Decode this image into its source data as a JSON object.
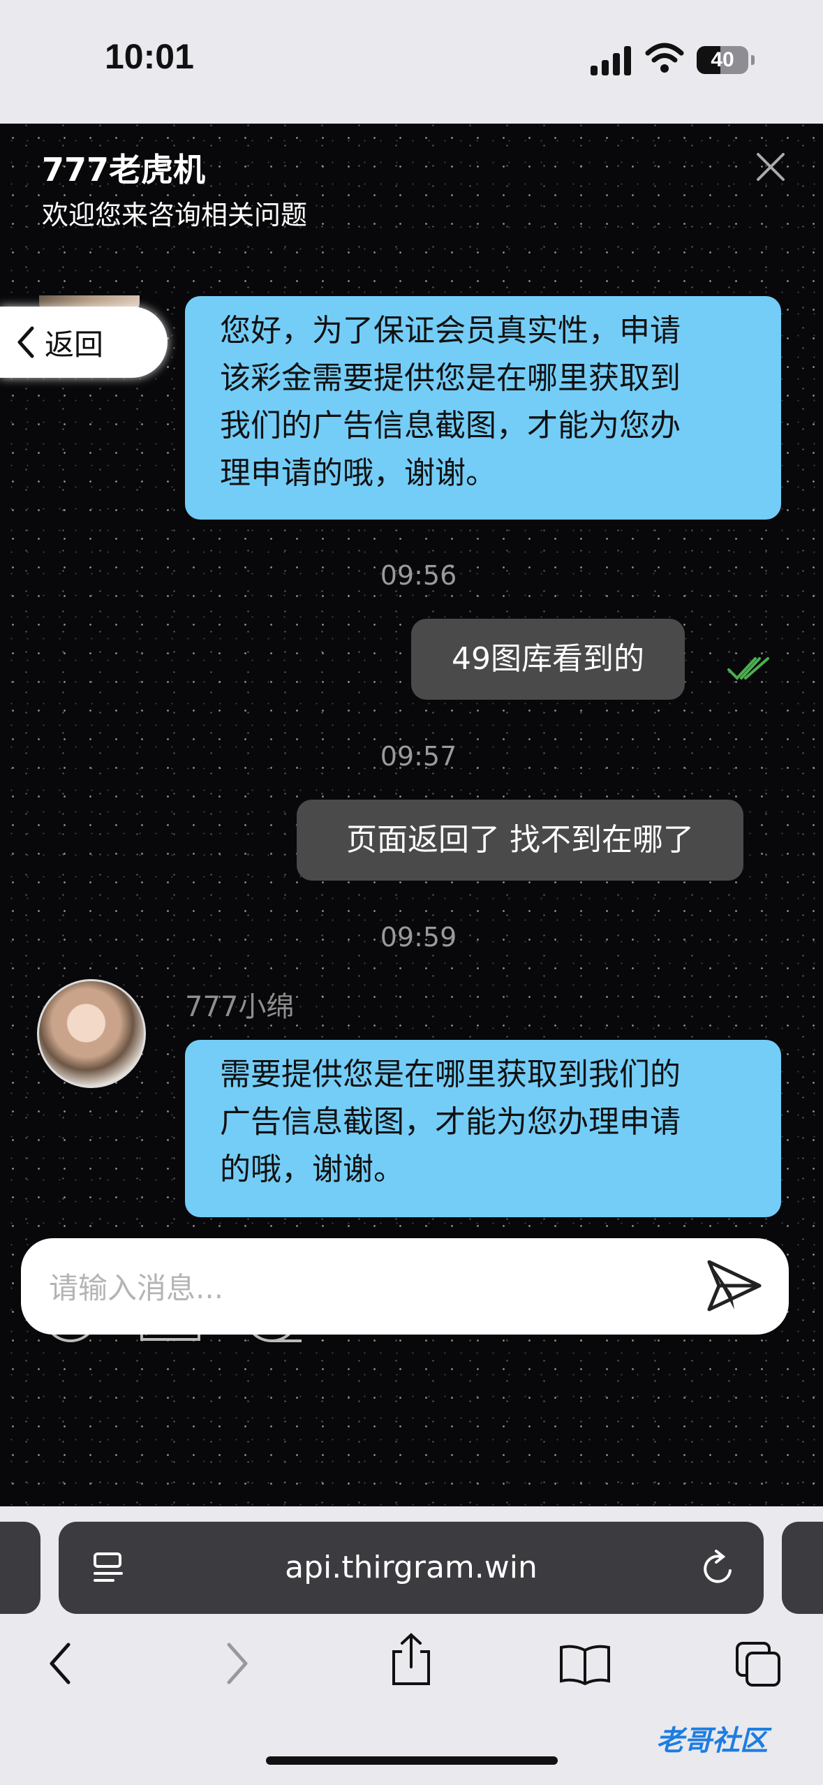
{
  "status": {
    "time": "10:01",
    "battery": "40"
  },
  "header": {
    "title": "777老虎机",
    "subtitle": "欢迎您来咨询相关问题"
  },
  "back_label": "返回",
  "messages": {
    "m1": [
      "您好，为了保证会员真实性，申请",
      "该彩金需要提供您是在哪里获取到",
      "我们的广告信息截图，才能为您办",
      "理申请的哦，谢谢。"
    ],
    "t1": "09:56",
    "m2": "49图库看到的",
    "t2": "09:57",
    "m3": "页面返回了 找不到在哪了",
    "t3": "09:59",
    "sender": "777小绵",
    "m4": [
      "需要提供您是在哪里获取到我们的",
      "广告信息截图，才能为您办理申请",
      "的哦，谢谢。"
    ]
  },
  "input": {
    "placeholder": "请输入消息..."
  },
  "browser": {
    "url": "api.thirgram.win"
  },
  "watermark": "老哥社区",
  "colors": {
    "incoming_bubble": "#74cdf7",
    "outgoing_bubble": "#4a4a4a",
    "read_check": "#4caf50"
  },
  "icons": [
    "signal-icon",
    "wifi-icon",
    "close-icon",
    "chevron-left-icon",
    "double-check-icon",
    "emoji-icon",
    "image-icon",
    "film-reel-icon",
    "send-icon",
    "reader-icon",
    "reload-icon",
    "share-icon",
    "bookmarks-icon",
    "tabs-icon"
  ]
}
